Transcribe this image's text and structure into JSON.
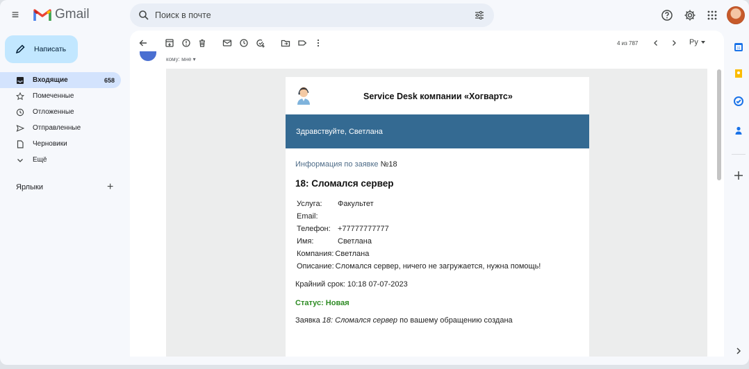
{
  "app": {
    "name": "Gmail"
  },
  "search": {
    "placeholder": "Поиск в почте"
  },
  "sidebar": {
    "compose_label": "Написать",
    "items": [
      {
        "label": "Входящие",
        "count": "658",
        "icon": "inbox-icon"
      },
      {
        "label": "Помеченные",
        "icon": "star-icon"
      },
      {
        "label": "Отложенные",
        "icon": "clock-icon"
      },
      {
        "label": "Отправленные",
        "icon": "send-icon"
      },
      {
        "label": "Черновики",
        "icon": "draft-icon"
      },
      {
        "label": "Ещё",
        "icon": "chevron-down-icon"
      }
    ],
    "labels_heading": "Ярлыки",
    "labels_add": "+"
  },
  "toolbar": {
    "pager_text": "4 из 787",
    "lang": "Ру"
  },
  "message": {
    "to_line": "кому: мне ▾"
  },
  "email": {
    "title": "Service Desk компании «Хогвартс»",
    "greeting": "Здравствуйте, Светлана",
    "info_prefix": "Информация по заявке ",
    "info_number": "№18",
    "ticket_title": "18: Сломался сервер",
    "fields": [
      {
        "label": "Услуга:",
        "value": "Факультет"
      },
      {
        "label": "Email:",
        "value": ""
      },
      {
        "label": "Телефон:",
        "value": "+77777777777"
      },
      {
        "label": "Имя:",
        "value": "Светлана"
      },
      {
        "label": "Компания:",
        "value": "Светлана"
      },
      {
        "label": "Описание:",
        "value": "Сломался сервер, ничего не загружается, нужна помощь!"
      }
    ],
    "deadline": "Крайний срок: 10:18 07-07-2023",
    "status": "Статус: Новая",
    "footer_prefix": "Заявка ",
    "footer_italic": "18: Сломался сервер",
    "footer_suffix": " по вашему обращению создана"
  },
  "colors": {
    "accent_header": "#346a92",
    "status_green": "#2e8b24",
    "compose_bg": "#c2e7ff",
    "active_nav": "#d3e3fd"
  }
}
